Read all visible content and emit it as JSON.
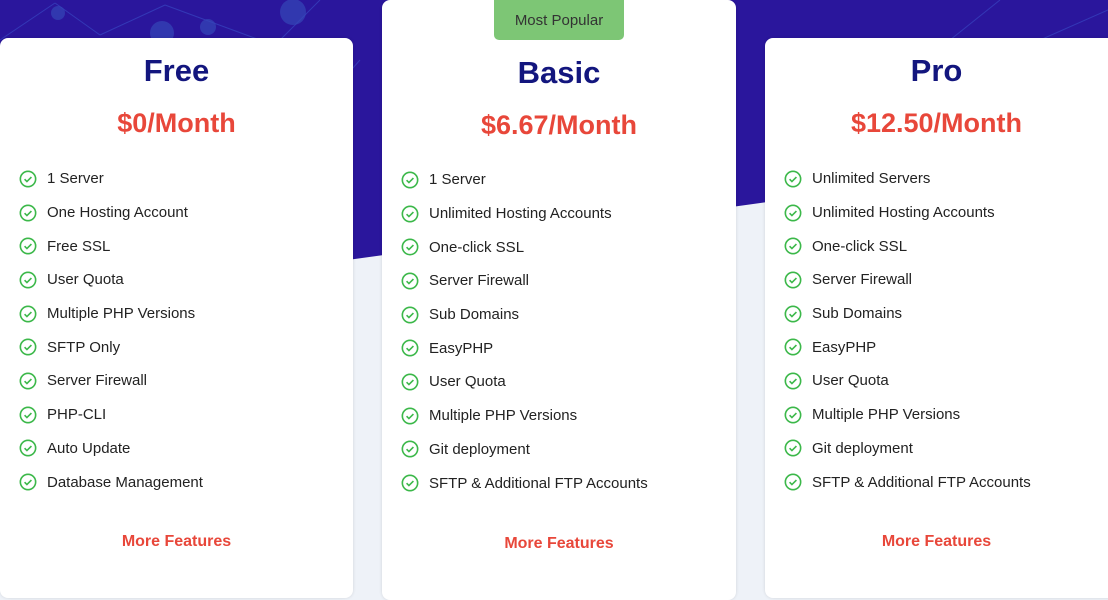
{
  "colors": {
    "header_bg": "#2a169c",
    "title": "#13167e",
    "price": "#e8473a",
    "check": "#3cb84a",
    "badge": "#7dc675"
  },
  "plans": [
    {
      "name": "Free",
      "price": "$0/Month",
      "features": [
        "1 Server",
        "One Hosting Account",
        "Free SSL",
        "User Quota",
        "Multiple PHP Versions",
        "SFTP Only",
        "Server Firewall",
        "PHP-CLI",
        "Auto Update",
        "Database Management"
      ],
      "more": "More Features"
    },
    {
      "name": "Basic",
      "badge": "Most Popular",
      "price": "$6.67/Month",
      "features": [
        "1 Server",
        "Unlimited Hosting Accounts",
        "One-click SSL",
        "Server Firewall",
        "Sub Domains",
        "EasyPHP",
        "User Quota",
        "Multiple PHP Versions",
        "Git deployment",
        "SFTP & Additional FTP Accounts"
      ],
      "more": "More Features"
    },
    {
      "name": "Pro",
      "price": "$12.50/Month",
      "features": [
        "Unlimited Servers",
        "Unlimited Hosting Accounts",
        "One-click SSL",
        "Server Firewall",
        "Sub Domains",
        "EasyPHP",
        "User Quota",
        "Multiple PHP Versions",
        "Git deployment",
        "SFTP & Additional FTP Accounts"
      ],
      "more": "More Features"
    }
  ]
}
